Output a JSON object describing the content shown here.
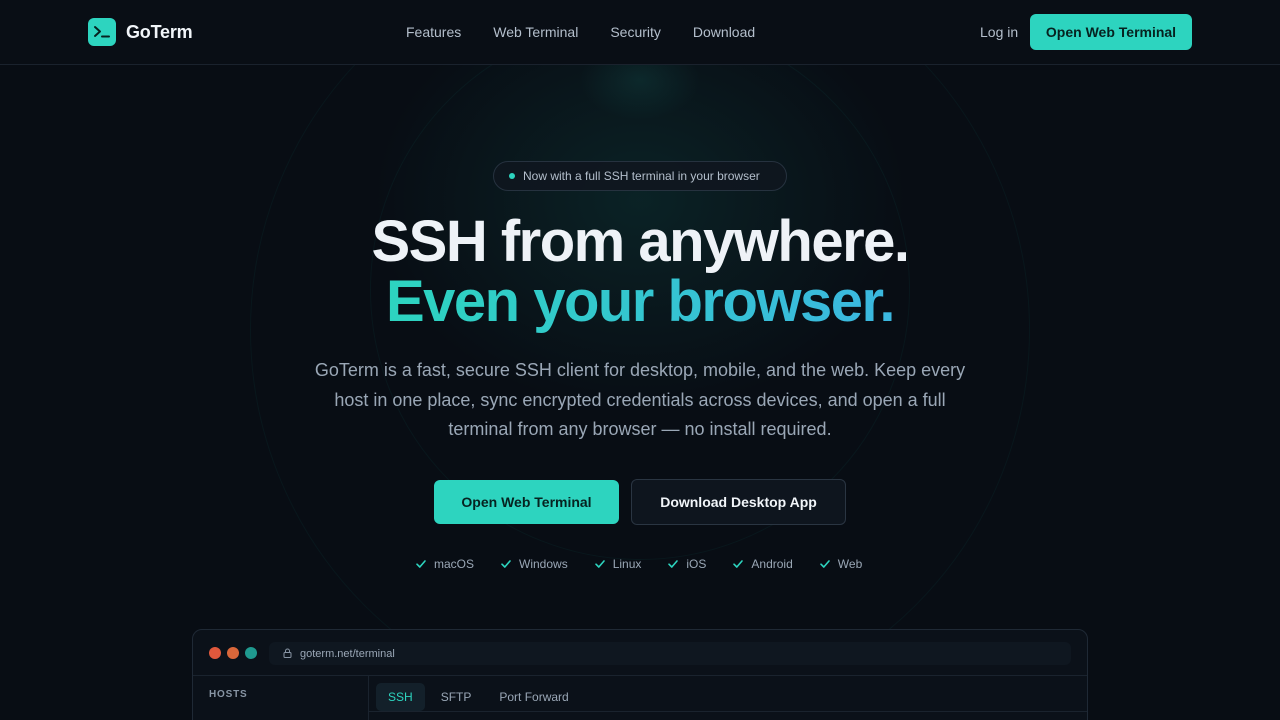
{
  "nav": {
    "brand": "GoTerm",
    "links": [
      "Features",
      "Web Terminal",
      "Security",
      "Download"
    ],
    "login": "Log in",
    "cta": "Open Web Terminal"
  },
  "hero": {
    "badge": "Now with a full SSH terminal in your browser",
    "title_line1": "SSH from anywhere.",
    "title_line2": "Even your browser.",
    "subtitle": "GoTerm is a fast, secure SSH client for desktop, mobile, and the web. Keep every host in one place, sync encrypted credentials across devices, and open a full terminal from any browser — no install required.",
    "primary_button": "Open Web Terminal",
    "secondary_button": "Download Desktop App",
    "platforms": [
      "macOS",
      "Windows",
      "Linux",
      "iOS",
      "Android",
      "Web"
    ]
  },
  "terminal_preview": {
    "url": "goterm.net/terminal",
    "sidebar_heading": "HOSTS",
    "tabs": [
      "SSH",
      "SFTP",
      "Port Forward"
    ],
    "active_tab": "SSH"
  },
  "colors": {
    "accent": "#2dd4bf",
    "accent_gradient_end": "#3bb7e0",
    "background": "#080d14",
    "traffic_red": "#e0583c",
    "traffic_orange": "#d9673a",
    "traffic_teal": "#1f9a8f"
  },
  "icons": {
    "logo": "terminal-prompt-icon",
    "badge": "status-dot-icon",
    "platform_check": "check-icon",
    "url": "lock-icon"
  }
}
